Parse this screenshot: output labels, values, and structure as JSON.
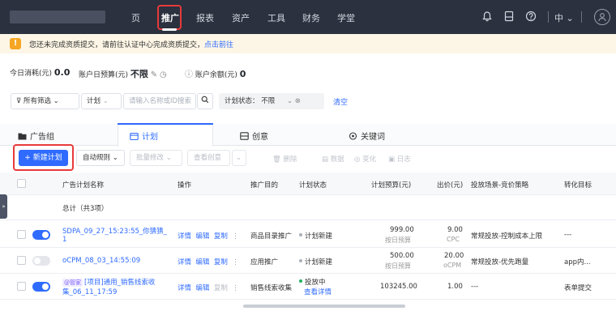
{
  "nav": {
    "items": [
      "页",
      "推广",
      "报表",
      "资产",
      "工具",
      "财务",
      "学堂"
    ],
    "lang": "中",
    "avatar_icon": "user-icon"
  },
  "notice": {
    "text": "您还未完成资质提交，请前往认证中心完成资质提交，",
    "link": "点击前往"
  },
  "stats": {
    "today_label": "今日消耗(元)",
    "today_value": "0.0",
    "budget_label": "账户日预算(元)",
    "budget_value": "不限",
    "balance_label": "账户余额(元)",
    "balance_value": "0"
  },
  "filters": {
    "all_filter": "所有筛选",
    "plan_select": "计划",
    "search_placeholder": "请输入名称或ID搜索",
    "status_label": "计划状态：",
    "status_value": "不限",
    "clear": "清空"
  },
  "tabs": [
    "广告组",
    "计划",
    "创意",
    "关键词"
  ],
  "toolbar": {
    "new_plan": "+ 新建计划",
    "auto_rules": "自动规则",
    "batch_edit": "批量修改",
    "view_creative": "查看创意",
    "delete": "删除",
    "data": "数据",
    "change": "变化",
    "log": "日志"
  },
  "table": {
    "headers": [
      "广告计划名称",
      "操作",
      "推广目的",
      "计划状态",
      "计划预算(元)",
      "出价(元)",
      "投放场景-竞价策略",
      "转化目标"
    ],
    "total": "总计（共3项）",
    "actions": [
      "详情",
      "编辑",
      "复制"
    ],
    "rows": [
      {
        "name_line1": "SDPA_09_27_15:23:55_你猜猜_",
        "name_line2": "1",
        "purpose": "商品目录推广",
        "status": "计划新建",
        "status_sub": "",
        "budget": "999.00",
        "budget_sub": "按日预算",
        "bid": "9.00",
        "bid_sub": "CPC",
        "strategy": "常规投放-控制成本上限",
        "goal": "---"
      },
      {
        "name_line1": "oCPM_08_03_14:55:09",
        "name_line2": "",
        "purpose": "应用推广",
        "status": "计划新建",
        "status_sub": "",
        "budget": "500.00",
        "budget_sub": "按日预算",
        "bid": "20.00",
        "bid_sub": "oCPM",
        "strategy": "常规投放-优先跑量",
        "goal": "app内..."
      },
      {
        "tag": "@管家",
        "name_line1": "[项目]通用_销售线索收",
        "name_line2": "集_06_11_17:59",
        "purpose": "销售线索收集",
        "status": "投放中",
        "status_sub": "查看详情",
        "budget": "103245.00",
        "budget_sub": "",
        "bid": "1.00",
        "bid_sub": "",
        "strategy": "---",
        "goal": "表单提交"
      }
    ]
  },
  "colors": {
    "nav_bg": "#2b313f",
    "accent": "#2f6bff",
    "highlight": "#e83a3a",
    "warning": "#f5a623"
  }
}
